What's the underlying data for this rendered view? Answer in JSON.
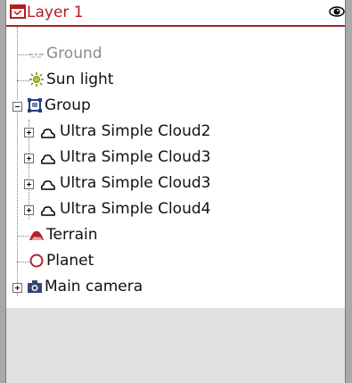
{
  "layer": {
    "label": "Layer 1"
  },
  "items": [
    {
      "label": "Ground",
      "icon": "ground-icon",
      "muted": true
    },
    {
      "label": "Sun light",
      "icon": "sun-light-icon"
    },
    {
      "label": "Group",
      "icon": "group-icon"
    },
    {
      "label": "Ultra Simple Cloud2",
      "icon": "cloud-icon"
    },
    {
      "label": "Ultra Simple Cloud3",
      "icon": "cloud-icon"
    },
    {
      "label": "Ultra Simple Cloud3",
      "icon": "cloud-icon"
    },
    {
      "label": "Ultra Simple Cloud4",
      "icon": "cloud-icon"
    },
    {
      "label": "Terrain",
      "icon": "terrain-icon"
    },
    {
      "label": "Planet",
      "icon": "planet-icon"
    },
    {
      "label": "Main camera",
      "icon": "camera-icon"
    }
  ]
}
